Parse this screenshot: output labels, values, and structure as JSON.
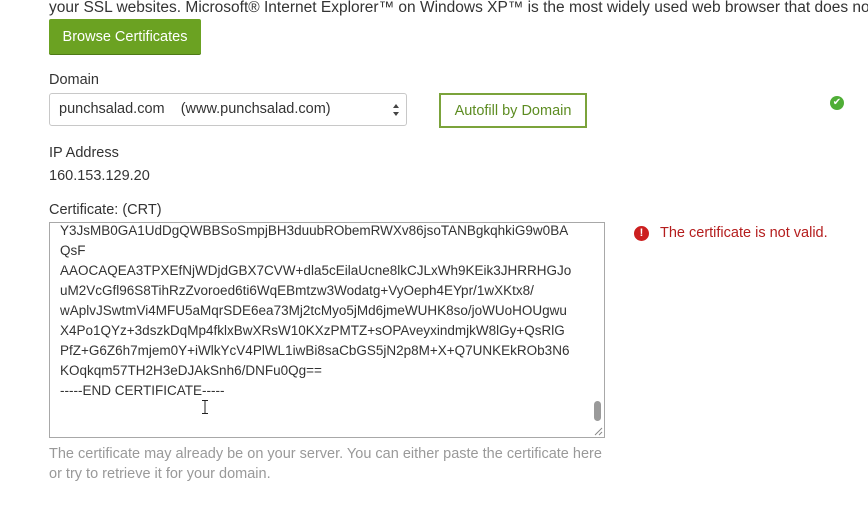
{
  "intro_text": "your SSL websites. Microsoft® Internet Explorer™ on Windows XP™ is the most widely used web browser that does not support S",
  "browse_button": "Browse Certificates",
  "domain": {
    "label": "Domain",
    "selected": "punchsalad.com    (www.punchsalad.com)",
    "autofill_button": "Autofill by Domain"
  },
  "ip": {
    "label": "IP Address",
    "value": "160.153.129.20"
  },
  "certificate": {
    "label": "Certificate: (CRT)",
    "content": "Y3JsMB0GA1UdDgQWBBSoSmpjBH3duubRObemRWXv86jsoTANBgkqhkiG9w0BA\nQsF\nAAOCAQEA3TPXEfNjWDjdGBX7CVW+dla5cEilaUcne8lkCJLxWh9KEik3JHRRHGJo\nuM2VcGfl96S8TihRzZvoroed6ti6WqEBmtzw3Wodatg+VyOeph4EYpr/1wXKtx8/\nwAplvJSwtmVi4MFU5aMqrSDE6ea73Mj2tcMyo5jMd6jmeWUHK8so/joWUoHOUgwu\nX4Po1QYz+3dszkDqMp4fklxBwXRsW10KXzPMTZ+sOPAveyxindmjkW8lGy+QsRlG\nPfZ+G6Z6h7mjem0Y+iWlkYcV4PlWL1iwBi8saCbGS5jN2p8M+X+Q7UNKEkROb3N6\nKOqkqm57TH2H3eDJAkSnh6/DNFu0Qg==\n-----END CERTIFICATE-----",
    "error": "The certificate is not valid.",
    "help": "The certificate may already be on your server. You can either paste the certificate here or try to retrieve it for your domain."
  },
  "colors": {
    "accent_green": "#6ba222",
    "autofill_border": "#7ba33b",
    "error_red": "#cc1f1f",
    "success_green": "#4fae36"
  },
  "icons": {
    "domain_status": "checkmark-circle-icon",
    "certificate_status": "exclamation-circle-icon"
  }
}
